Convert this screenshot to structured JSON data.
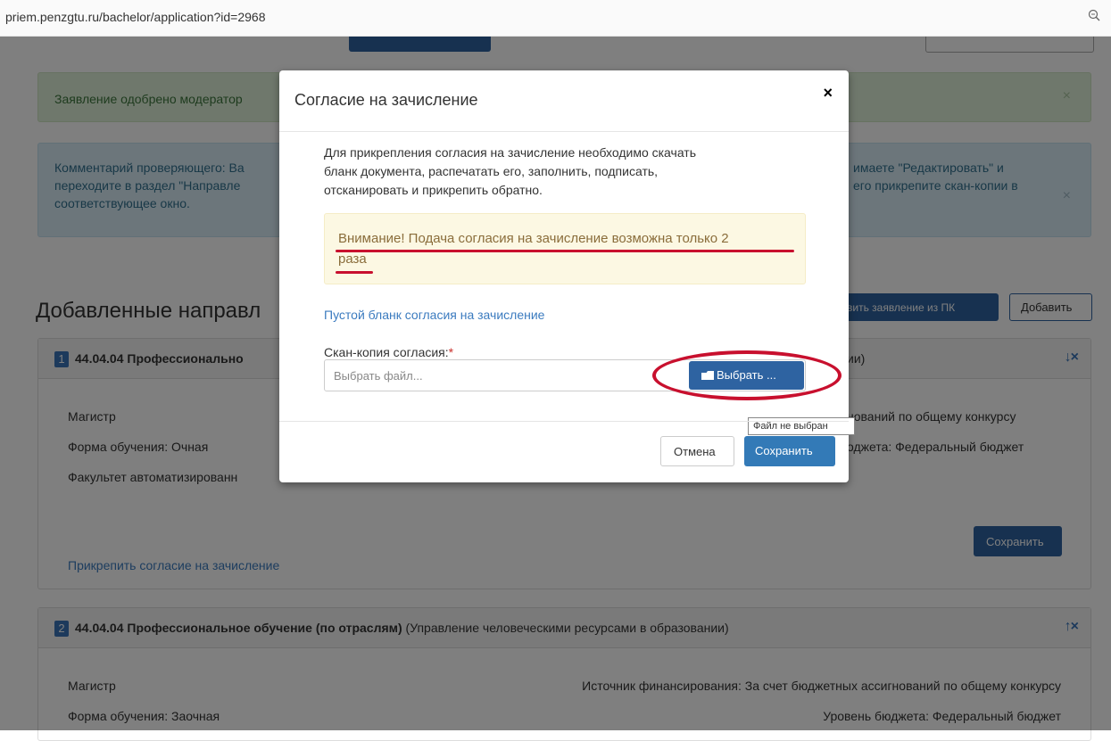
{
  "browser": {
    "url": "priem.penzgtu.ru/bachelor/application?id=2968"
  },
  "alerts": {
    "success_text": "Заявление одобрено модератор",
    "info_left": [
      "Комментарий проверяющего: Ва",
      "переходите в раздел \"Направле",
      "соответствующее окно."
    ],
    "info_right": [
      "имаете \"Редактировать\" и",
      "его прикрепите скан-копии в"
    ],
    "close": "×"
  },
  "section": {
    "title": "Добавленные направл",
    "pk_button": "вить заявление из ПК",
    "add_button": "Добавить"
  },
  "panels": [
    {
      "number": "1",
      "title": "44.04.04 Профессионально",
      "title_right": "ии)",
      "arrows": "↓×",
      "degree": "Магистр",
      "form": "Форма обучения: Очная",
      "faculty": "Факультет автоматизированн",
      "funding_right": "нований по общему конкурсу",
      "budget_right": "оджета: Федеральный бюджет",
      "save_label": "Сохранить",
      "attach_link": "Прикрепить согласие на зачисление"
    },
    {
      "number": "2",
      "title": "44.04.04 Профессиональное обучение (по отраслям)",
      "subtitle": "(Управление человеческими ресурсами в образовании)",
      "arrows": "↑×",
      "degree": "Магистр",
      "form": "Форма обучения: Заочная",
      "funding": "Источник финансирования: За счет бюджетных ассигнований по общему конкурсу",
      "budget": "Уровень бюджета: Федеральный бюджет"
    }
  ],
  "modal": {
    "title": "Согласие на зачисление",
    "close": "×",
    "paragraph": [
      "Для прикрепления согласия на зачисление необходимо скачать",
      "бланк документа, распечатать его, заполнить, подписать,",
      "отсканировать и прикрепить обратно."
    ],
    "warning": [
      "Внимание! Подача согласия на зачисление возможна только 2",
      "раза"
    ],
    "blank_link": "Пустой бланк согласия на зачисление",
    "file_label": "Скан-копия согласия:",
    "required_mark": "*",
    "file_placeholder": "Выбрать файл...",
    "choose_button": "Выбрать ...",
    "tooltip": "Файл не выбран",
    "cancel_button": "Отмена",
    "save_button": "Сохранить"
  },
  "colors": {
    "primary": "#2e63a1",
    "annotation_red": "#c8102e",
    "warning_bg": "#fcf8e3"
  }
}
